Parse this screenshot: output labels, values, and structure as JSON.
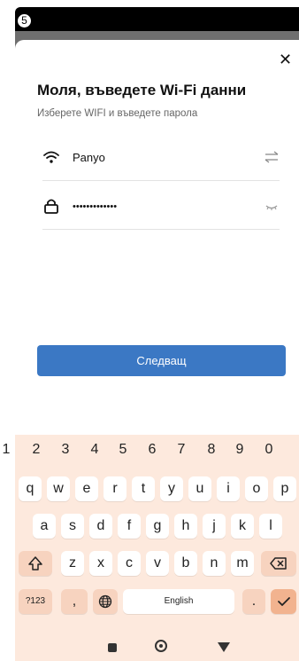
{
  "status": {
    "step_badge": "5"
  },
  "dialog": {
    "title": "Моля, въведете Wi-Fi данни",
    "subtitle": "Изберете WIFI и въведете парола",
    "close_icon": "close-icon"
  },
  "wifi": {
    "ssid": "Panyo",
    "icon": "wifi-icon",
    "trail_icon": "swap-icon"
  },
  "password": {
    "masked_value": "•••••••••••••",
    "icon": "lock-icon",
    "trail_icon": "eye-hidden-icon"
  },
  "next_button": {
    "label": "Следващ",
    "color": "#3b78c4"
  },
  "keyboard": {
    "numbers": [
      "1",
      "2",
      "3",
      "4",
      "5",
      "6",
      "7",
      "8",
      "9",
      "0"
    ],
    "row1": [
      "q",
      "w",
      "e",
      "r",
      "t",
      "y",
      "u",
      "i",
      "o",
      "p"
    ],
    "row2": [
      "a",
      "s",
      "d",
      "f",
      "g",
      "h",
      "j",
      "k",
      "l"
    ],
    "row3": [
      "z",
      "x",
      "c",
      "v",
      "b",
      "n",
      "m"
    ],
    "symbols_key": "?123",
    "comma_key": ",",
    "space_key": "English",
    "period_key": "."
  },
  "navbar": {
    "back": "square",
    "home": "circle",
    "recent": "triangle"
  }
}
